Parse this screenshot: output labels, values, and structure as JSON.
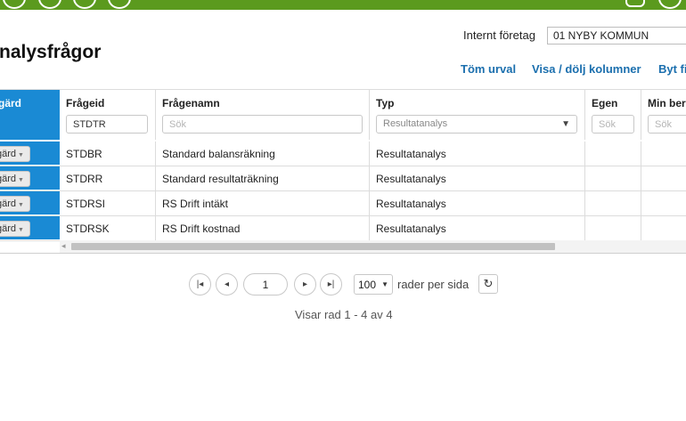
{
  "header": {
    "title": "nalysfrågor",
    "company_label": "Internt företag",
    "company_value": "01 NYBY KOMMUN"
  },
  "links": {
    "clear": "Töm urval",
    "toggle_columns": "Visa / dölj kolumner",
    "switch": "Byt fi"
  },
  "table": {
    "columns": {
      "action": "gärd",
      "id": "Frågeid",
      "name": "Frågenamn",
      "type": "Typ",
      "own": "Egen",
      "min": "Min ber"
    },
    "filters": {
      "id_value": "STDTR",
      "name_placeholder": "Sök",
      "type_value": "Resultatanalys",
      "own_placeholder": "Sök",
      "min_placeholder": "Sök"
    },
    "rows": [
      {
        "action": "gärd",
        "id": "STDBR",
        "name": "Standard balansräkning",
        "type": "Resultatanalys"
      },
      {
        "action": "gärd",
        "id": "STDRR",
        "name": "Standard resultaträkning",
        "type": "Resultatanalys"
      },
      {
        "action": "gärd",
        "id": "STDRSI",
        "name": "RS Drift intäkt",
        "type": "Resultatanalys"
      },
      {
        "action": "gärd",
        "id": "STDRSK",
        "name": "RS Drift kostnad",
        "type": "Resultatanalys"
      }
    ]
  },
  "pager": {
    "page": "1",
    "rows_per_page": "100",
    "rows_label": "rader per sida",
    "status": "Visar rad 1 - 4 av 4"
  },
  "icons": {
    "first": "first-page-icon",
    "prev": "prev-page-icon",
    "next": "next-page-icon",
    "last": "last-page-icon",
    "refresh": "refresh-icon"
  },
  "colors": {
    "topbar": "#5b9a1e",
    "accent": "#1a8ad4",
    "link": "#1b6fae"
  }
}
